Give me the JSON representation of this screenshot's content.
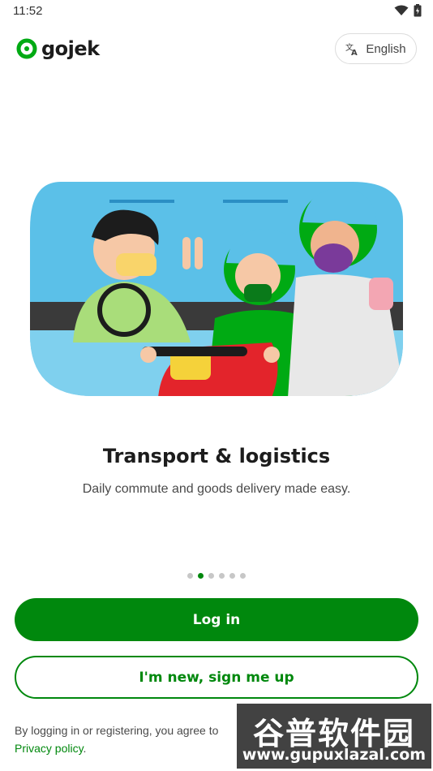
{
  "status_bar": {
    "time": "11:52",
    "icons": [
      "wifi-icon",
      "battery-icon"
    ]
  },
  "header": {
    "brand": "gojek",
    "language_button": {
      "label": "English",
      "icon": "translate-icon"
    }
  },
  "onboarding": {
    "title": "Transport & logistics",
    "subtitle": "Daily commute and goods delivery made easy.",
    "page_indicator": {
      "count": 6,
      "active_index": 1
    }
  },
  "actions": {
    "login_label": "Log in",
    "signup_label": "I'm new, sign me up"
  },
  "legal": {
    "prefix": "By logging in or registering, you agree to",
    "privacy_link": "Privacy policy",
    "suffix": "."
  },
  "watermark": {
    "title": "谷普软件园",
    "url": "www.gupuxlazal.com"
  },
  "colors": {
    "brand_green": "#00880d",
    "text_dark": "#1c1c1c",
    "text_muted": "#4a4a4a"
  }
}
